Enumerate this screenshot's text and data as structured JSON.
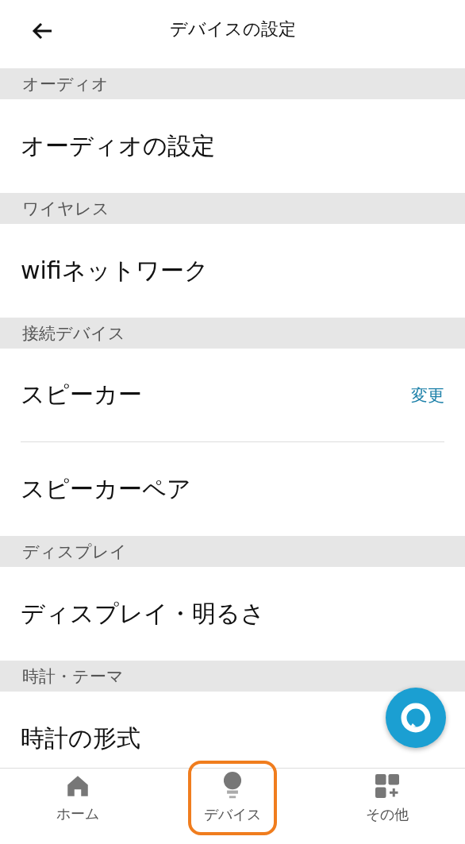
{
  "header": {
    "title": "デバイスの設定"
  },
  "sections": [
    {
      "title": "オーディオ",
      "items": [
        {
          "label": "オーディオの設定"
        }
      ]
    },
    {
      "title": "ワイヤレス",
      "items": [
        {
          "label": "wifiネットワーク"
        }
      ]
    },
    {
      "title": "接続デバイス",
      "items": [
        {
          "label": "スピーカー",
          "action": "変更"
        },
        {
          "label": "スピーカーペア"
        }
      ]
    },
    {
      "title": "ディスプレイ",
      "items": [
        {
          "label": "ディスプレイ・明るさ"
        }
      ]
    },
    {
      "title": "時計・テーマ",
      "items": [
        {
          "label": "時計の形式"
        }
      ]
    }
  ],
  "bottom_nav": [
    {
      "kind": "home",
      "label": "ホーム",
      "highlighted": false
    },
    {
      "kind": "devices",
      "label": "デバイス",
      "highlighted": true
    },
    {
      "kind": "more",
      "label": "その他",
      "highlighted": false
    }
  ]
}
